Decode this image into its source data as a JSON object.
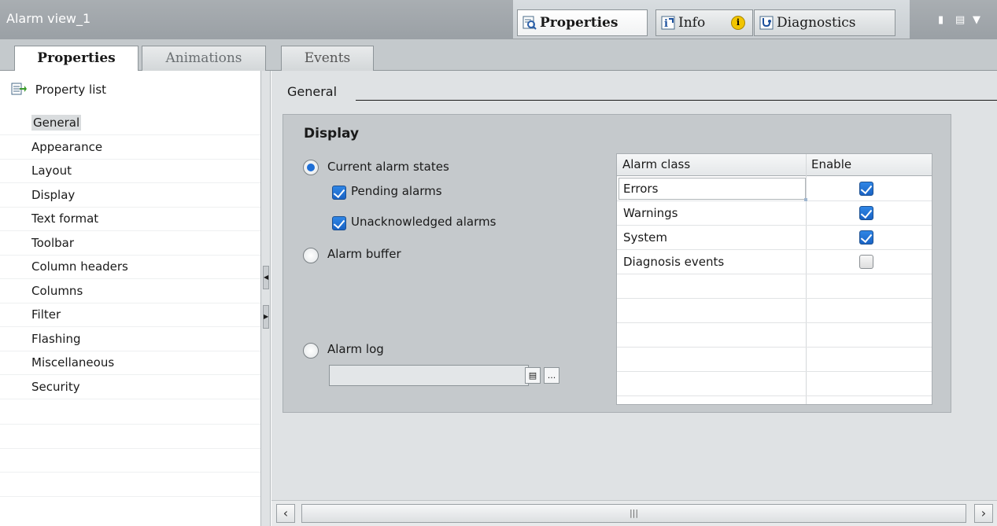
{
  "window": {
    "title": "Alarm view_1",
    "tabs": [
      {
        "label": "Properties",
        "icon": "properties-icon",
        "active": true
      },
      {
        "label": "Info",
        "icon": "info-icon",
        "badge": "i"
      },
      {
        "label": "Diagnostics",
        "icon": "diagnostics-icon"
      }
    ],
    "controls": [
      "restore-icon",
      "layout-icon",
      "dropdown-icon"
    ]
  },
  "inner_tabs": [
    "Properties",
    "Animations",
    "Events"
  ],
  "sidebar": {
    "header": "Property list",
    "items": [
      "General",
      "Appearance",
      "Layout",
      "Display",
      "Text format",
      "Toolbar",
      "Column headers",
      "Columns",
      "Filter",
      "Flashing",
      "Miscellaneous",
      "Security"
    ],
    "selected": "General"
  },
  "main": {
    "section_title": "General",
    "display": {
      "title": "Display",
      "options": {
        "current": "Current alarm states",
        "pending": "Pending alarms",
        "unack": "Unacknowledged alarms",
        "buffer": "Alarm buffer",
        "log": "Alarm log"
      },
      "selected_option": "Current alarm states",
      "log_field_value": "",
      "table": {
        "headers": [
          "Alarm class",
          "Enable"
        ],
        "rows": [
          {
            "name": "Errors",
            "enabled": true
          },
          {
            "name": "Warnings",
            "enabled": true
          },
          {
            "name": "System",
            "enabled": true
          },
          {
            "name": "Diagnosis events",
            "enabled": false
          }
        ]
      }
    }
  },
  "colors": {
    "accent": "#1f6fd6",
    "panel": "#c5c9cc",
    "title_bar": "#9aa0a5"
  }
}
